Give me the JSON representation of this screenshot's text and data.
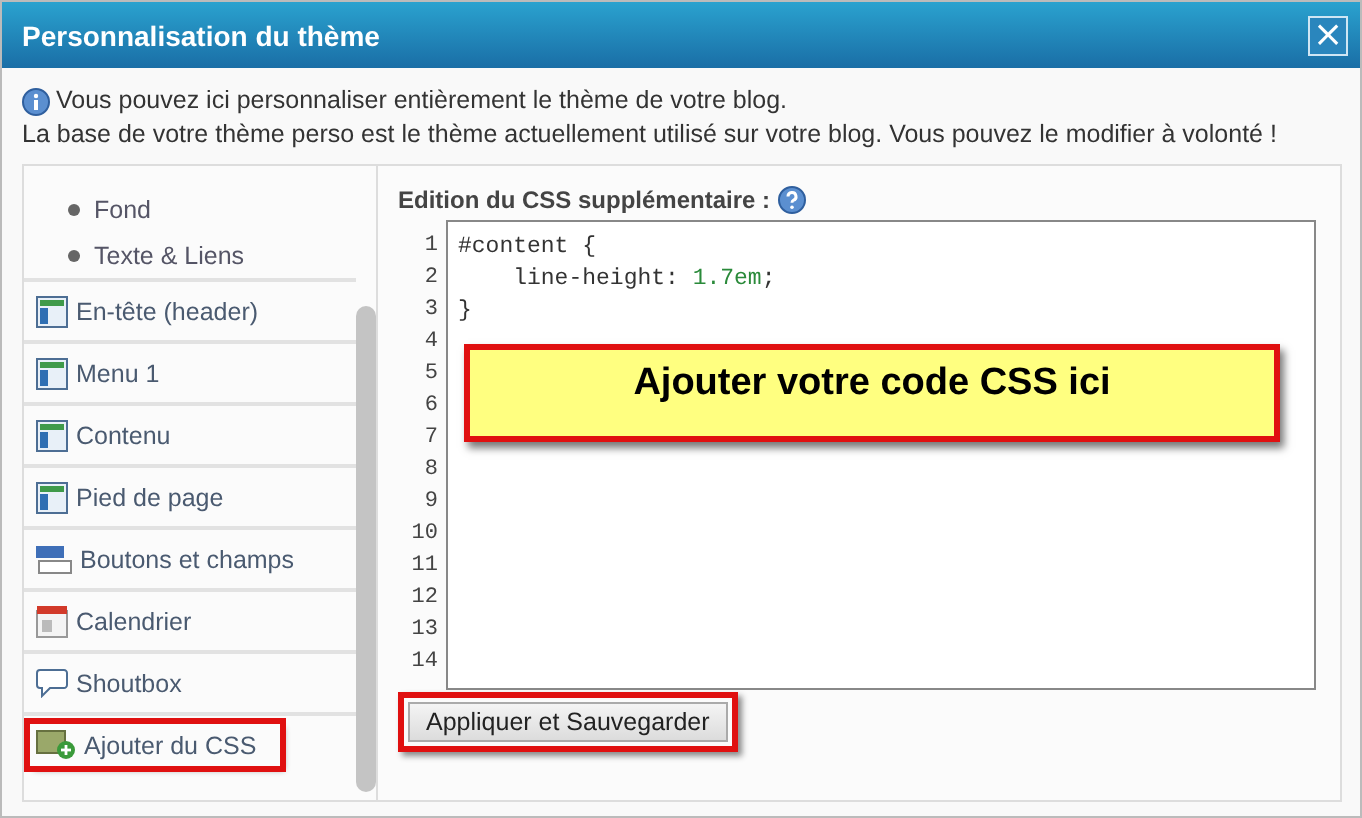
{
  "window": {
    "title": "Personnalisation du thème",
    "close": "×"
  },
  "info": [
    "Vous pouvez ici personnaliser entièrement le thème de votre blog.",
    "La base de votre thème perso est le thème actuellement utilisé sur votre blog. Vous pouvez le modifier à volonté !"
  ],
  "sidebar": {
    "items": [
      {
        "label": "Fond",
        "kind": "subitem",
        "highlighted": false
      },
      {
        "label": "Texte & Liens",
        "kind": "subitem",
        "highlighted": false
      },
      {
        "label": "En-tête (header)",
        "kind": "section",
        "highlighted": false
      },
      {
        "label": "Menu 1",
        "kind": "section",
        "highlighted": false
      },
      {
        "label": "Contenu",
        "kind": "section",
        "highlighted": false
      },
      {
        "label": "Pied de page",
        "kind": "section",
        "highlighted": false
      },
      {
        "label": "Boutons et champs",
        "kind": "section",
        "highlighted": false
      },
      {
        "label": "Calendrier",
        "kind": "section",
        "highlighted": false
      },
      {
        "label": "Shoutbox",
        "kind": "section",
        "highlighted": false
      },
      {
        "label": "Ajouter du CSS",
        "kind": "section",
        "highlighted": true
      }
    ]
  },
  "editor": {
    "label": "Edition du CSS supplémentaire :",
    "line_numbers": [
      "1",
      "2",
      "3",
      "4",
      "5",
      "6",
      "7",
      "8",
      "9",
      "10",
      "11",
      "12",
      "13",
      "14"
    ],
    "code": [
      [
        {
          "text": "#content {",
          "kind": "plain"
        }
      ],
      [
        {
          "text": "    line-height: ",
          "kind": "plain"
        },
        {
          "text": "1.7em",
          "kind": "number"
        },
        {
          "text": ";",
          "kind": "plain"
        }
      ],
      [
        {
          "text": "}",
          "kind": "plain"
        }
      ]
    ],
    "callout": "Ajouter votre code CSS ici",
    "button": {
      "label": "Appliquer et Sauvegarder",
      "highlighted": true
    }
  }
}
